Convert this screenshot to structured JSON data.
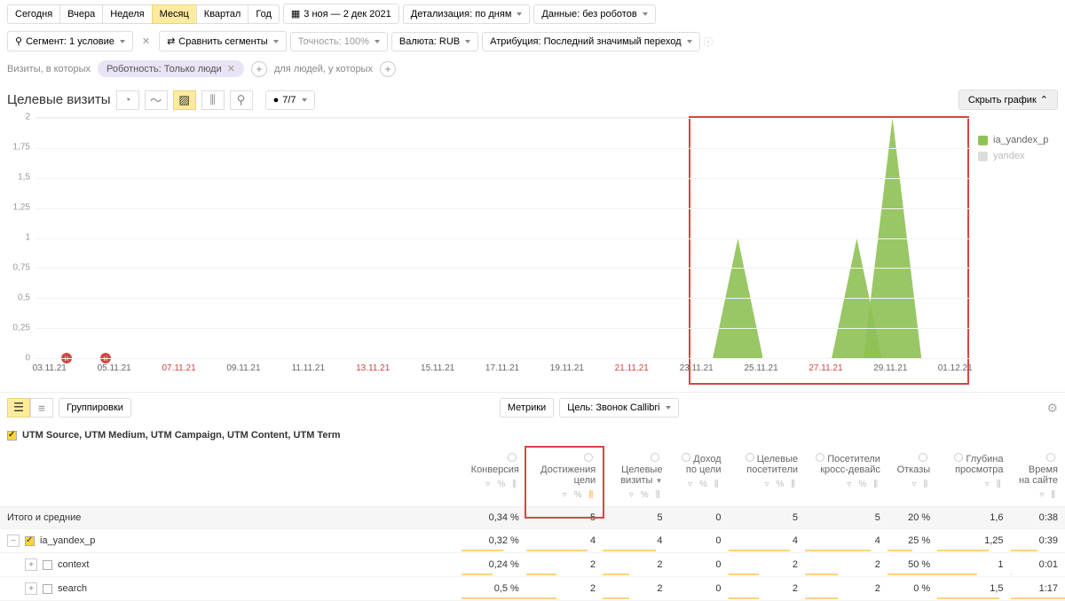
{
  "periods": {
    "today": "Сегодня",
    "yesterday": "Вчера",
    "week": "Неделя",
    "month": "Месяц",
    "quarter": "Квартал",
    "year": "Год"
  },
  "dateRange": "3 ноя — 2 дек 2021",
  "detail": "Детализация: по дням",
  "dataOpt": "Данные: без роботов",
  "segment": {
    "label": "Сегмент: 1 условие",
    "compare": "Сравнить сегменты",
    "accuracy": "Точность: 100%",
    "currency": "Валюта: RUB",
    "attribution": "Атрибуция: Последний значимый переход"
  },
  "filterRow": {
    "visits": "Визиты, в которых",
    "robot": "Роботность: Только люди",
    "people": "для людей, у которых"
  },
  "chart": {
    "title": "Целевые визиты",
    "series": "7/7",
    "hide": "Скрыть график"
  },
  "legend": {
    "s1": "ia_yandex_p",
    "s2": "yandex"
  },
  "chart_data": {
    "type": "area",
    "ylim": [
      0,
      2
    ],
    "yticks": [
      0,
      0.25,
      0.5,
      0.75,
      1,
      1.25,
      1.5,
      1.75,
      2
    ],
    "categories": [
      "03.11.21",
      "05.11.21",
      "07.11.21",
      "09.11.21",
      "11.11.21",
      "13.11.21",
      "15.11.21",
      "17.11.21",
      "19.11.21",
      "21.11.21",
      "23.11.21",
      "25.11.21",
      "27.11.21",
      "29.11.21",
      "01.12.21"
    ],
    "red_ticks": [
      "07.11.21",
      "13.11.21",
      "21.11.21",
      "27.11.21"
    ],
    "series": [
      {
        "name": "ia_yandex_p",
        "color": "#8fc255",
        "peaks": [
          {
            "x": "24.11.21",
            "value": 1
          },
          {
            "x": "28.11.21",
            "value": 1
          },
          {
            "x": "29.11.21",
            "value": 2
          }
        ]
      }
    ],
    "markers": [
      {
        "x": "04.11.21",
        "label": "Н"
      },
      {
        "x": "05.11.21",
        "label": "Н"
      }
    ]
  },
  "controls": {
    "groupings": "Группировки",
    "metrics": "Метрики",
    "goal": "Цель: Звонок Callibri"
  },
  "utmHeader": "UTM Source, UTM Medium, UTM Campaign, UTM Content, UTM Term",
  "cols": {
    "conv": "Конверсия",
    "goals": "Достижения цели",
    "visits": "Целевые визиты",
    "income": "Доход по цели",
    "tvisit": "Целевые посетители",
    "cross": "Посетители кросс-девайс",
    "bounce": "Отказы",
    "depth": "Глубина просмотра",
    "time": "Время на сайте"
  },
  "rows": {
    "total": {
      "label": "Итого и средние",
      "conv": "0,34 %",
      "goals": "5",
      "visits": "5",
      "income": "0",
      "tvisit": "5",
      "cross": "5",
      "bounce": "20 %",
      "depth": "1,6",
      "time": "0:38"
    },
    "r1": {
      "label": "ia_yandex_p",
      "conv": "0,32 %",
      "goals": "4",
      "visits": "4",
      "income": "0",
      "tvisit": "4",
      "cross": "4",
      "bounce": "25 %",
      "depth": "1,25",
      "time": "0:39"
    },
    "r2": {
      "label": "context",
      "conv": "0,24 %",
      "goals": "2",
      "visits": "2",
      "income": "0",
      "tvisit": "2",
      "cross": "2",
      "bounce": "50 %",
      "depth": "1",
      "time": "0:01"
    },
    "r3": {
      "label": "search",
      "conv": "0,5 %",
      "goals": "2",
      "visits": "2",
      "income": "0",
      "tvisit": "2",
      "cross": "2",
      "bounce": "0 %",
      "depth": "1,5",
      "time": "1:17"
    }
  }
}
